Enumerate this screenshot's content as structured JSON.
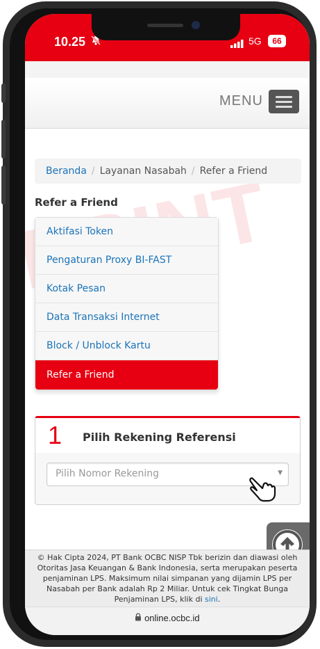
{
  "status_bar": {
    "time": "10.25",
    "network": "5G",
    "battery": "66"
  },
  "navbar": {
    "menu_label": "MENU"
  },
  "breadcrumb": {
    "home": "Beranda",
    "section": "Layanan Nasabah",
    "current": "Refer a Friend",
    "separator": "/"
  },
  "page": {
    "heading": "Refer a Friend"
  },
  "side_menu": {
    "items": [
      {
        "label": "Aktifasi Token"
      },
      {
        "label": "Pengaturan Proxy BI-FAST"
      },
      {
        "label": "Kotak Pesan"
      },
      {
        "label": "Data Transaksi Internet"
      },
      {
        "label": "Block / Unblock Kartu"
      },
      {
        "label": "Refer a Friend"
      }
    ],
    "active_index": 5
  },
  "step": {
    "number": "1",
    "title": "Pilih Rekening Referensi",
    "select_placeholder": "Pilih Nomor Rekening"
  },
  "footer": {
    "text": "© Hak Cipta 2024, PT Bank OCBC NISP Tbk berizin dan diawasi oleh Otoritas Jasa Keuangan & Bank Indonesia, serta merupakan peserta penjaminan LPS. Maksimum nilai simpanan yang dijamin LPS per Nasabah per Bank adalah Rp 2 Miliar. Untuk cek Tingkat Bunga Penjaminan LPS, klik di",
    "link_text": "sini",
    "end": "."
  },
  "browser": {
    "url": "online.ocbc.id"
  },
  "colors": {
    "brand_red": "#e60012",
    "link_blue": "#1a73b8"
  },
  "icons": {
    "scroll_top": "arrow-up-circle-icon",
    "pointer": "hand-pointer-icon",
    "lock": "lock-icon",
    "silent": "bell-slash-icon"
  }
}
